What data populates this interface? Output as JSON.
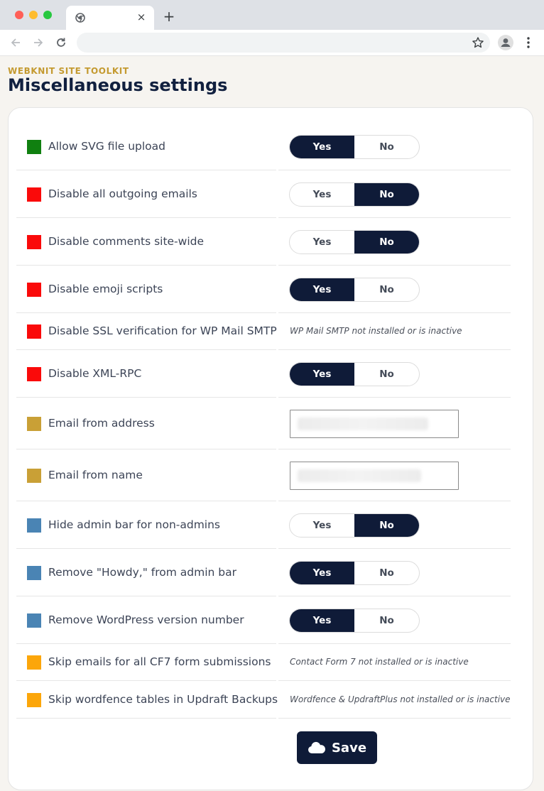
{
  "browser": {
    "tab_close_glyph": "×",
    "new_tab_glyph": "+"
  },
  "header": {
    "eyebrow": "WEBKNIT SITE TOOLKIT",
    "title": "Miscellaneous settings"
  },
  "colors": {
    "green": "#108010",
    "red": "#fa0a0a",
    "gold": "#c9a036",
    "steel": "#4a84b4",
    "orange": "#fca60a",
    "navy": "#0f1b38"
  },
  "settings": [
    {
      "label": "Allow SVG file upload",
      "color": "green",
      "type": "toggle",
      "value": "Yes",
      "options": [
        "Yes",
        "No"
      ]
    },
    {
      "label": "Disable all outgoing emails",
      "color": "red",
      "type": "toggle",
      "value": "No",
      "options": [
        "Yes",
        "No"
      ]
    },
    {
      "label": "Disable comments site-wide",
      "color": "red",
      "type": "toggle",
      "value": "No",
      "options": [
        "Yes",
        "No"
      ]
    },
    {
      "label": "Disable emoji scripts",
      "color": "red",
      "type": "toggle",
      "value": "Yes",
      "options": [
        "Yes",
        "No"
      ]
    },
    {
      "label": "Disable SSL verification for WP Mail SMTP",
      "color": "red",
      "type": "note",
      "note": "WP Mail SMTP not installed or is inactive"
    },
    {
      "label": "Disable XML-RPC",
      "color": "red",
      "type": "toggle",
      "value": "Yes",
      "options": [
        "Yes",
        "No"
      ]
    },
    {
      "label": "Email from address",
      "color": "gold",
      "type": "text",
      "value": ""
    },
    {
      "label": "Email from name",
      "color": "gold",
      "type": "text",
      "value": ""
    },
    {
      "label": "Hide admin bar for non-admins",
      "color": "steel",
      "type": "toggle",
      "value": "No",
      "options": [
        "Yes",
        "No"
      ]
    },
    {
      "label": "Remove \"Howdy,\" from admin bar",
      "color": "steel",
      "type": "toggle",
      "value": "Yes",
      "options": [
        "Yes",
        "No"
      ]
    },
    {
      "label": "Remove WordPress version number",
      "color": "steel",
      "type": "toggle",
      "value": "Yes",
      "options": [
        "Yes",
        "No"
      ]
    },
    {
      "label": "Skip emails for all CF7 form submissions",
      "color": "orange",
      "type": "note",
      "note": "Contact Form 7 not installed or is inactive"
    },
    {
      "label": "Skip wordfence tables in Updraft Backups",
      "color": "orange",
      "type": "note",
      "note": "Wordfence & UpdraftPlus not installed or is inactive"
    }
  ],
  "save": {
    "label": "Save",
    "icon": "cloud-icon"
  }
}
